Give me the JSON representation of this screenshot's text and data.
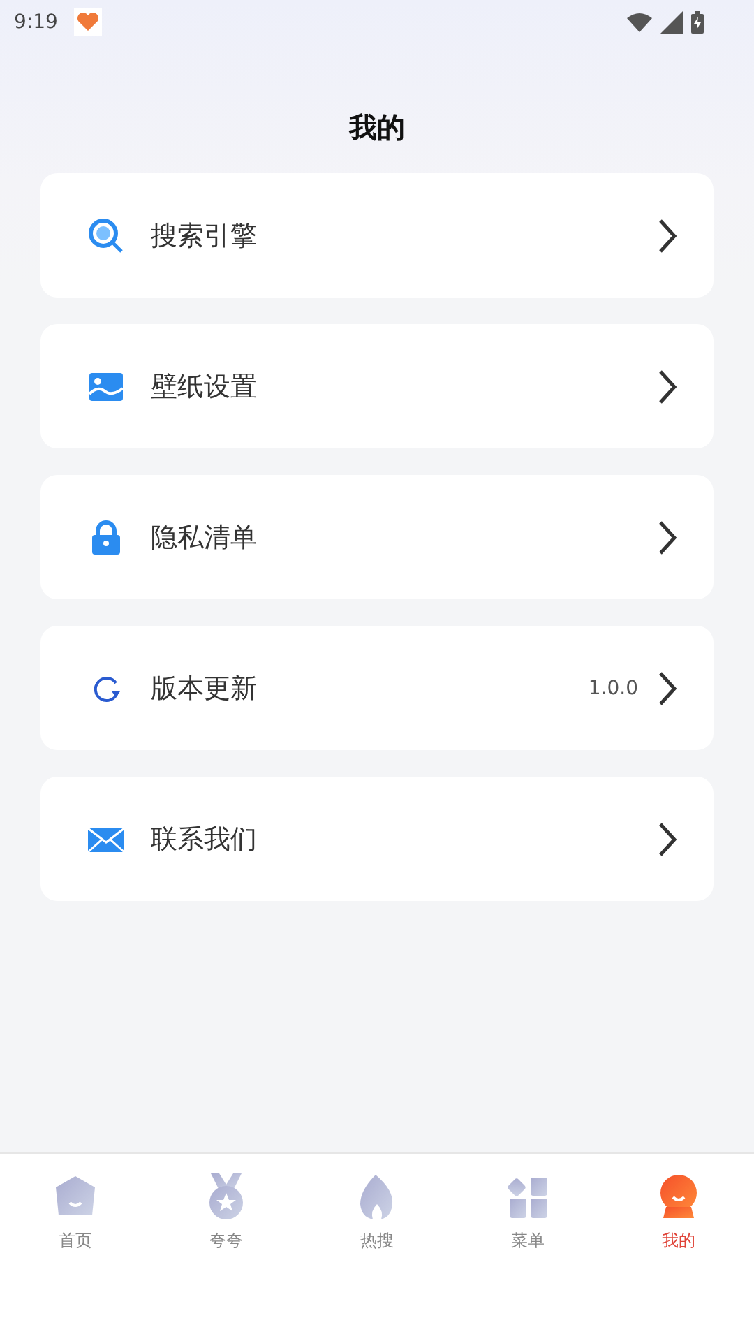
{
  "status_bar": {
    "time": "9:19"
  },
  "title": "我的",
  "menu": [
    {
      "kind": "search",
      "label": "搜索引擎"
    },
    {
      "kind": "image",
      "label": "壁纸设置"
    },
    {
      "kind": "lock",
      "label": "隐私清单"
    },
    {
      "kind": "refresh",
      "label": "版本更新",
      "value": "1.0.0"
    },
    {
      "kind": "mail",
      "label": "联系我们"
    }
  ],
  "tabs": [
    {
      "kind": "home",
      "label": "首页",
      "selected": false
    },
    {
      "kind": "medal",
      "label": "夸夸",
      "selected": false
    },
    {
      "kind": "flame",
      "label": "热搜",
      "selected": false
    },
    {
      "kind": "grid",
      "label": "菜单",
      "selected": false
    },
    {
      "kind": "profile",
      "label": "我的",
      "selected": true
    }
  ]
}
